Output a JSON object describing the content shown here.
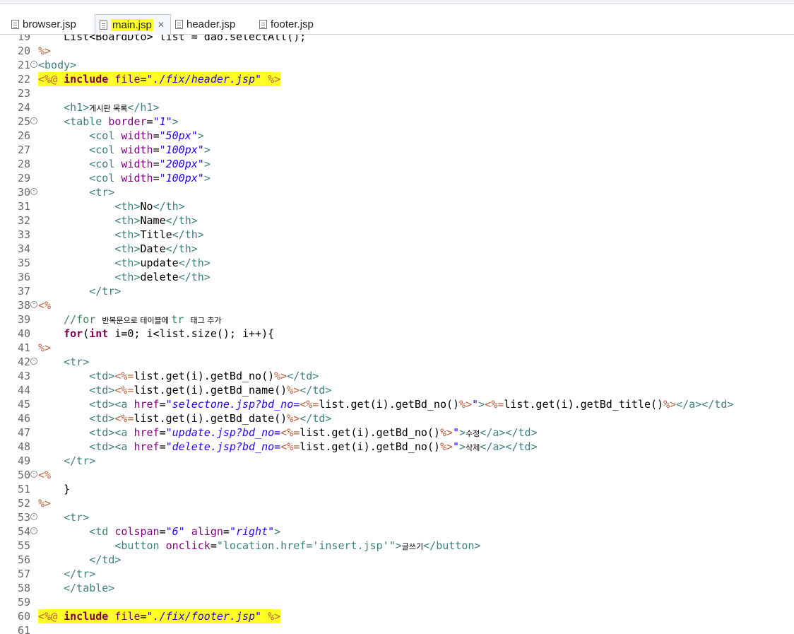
{
  "tabs": [
    {
      "name": "tab-browser",
      "label": "browser.jsp",
      "active": false,
      "highlight": false
    },
    {
      "name": "tab-main",
      "label": "main.jsp",
      "active": true,
      "highlight": true
    },
    {
      "name": "tab-header",
      "label": "header.jsp",
      "active": false,
      "highlight": false
    },
    {
      "name": "tab-footer",
      "label": "footer.jsp",
      "active": false,
      "highlight": false
    }
  ],
  "close_glyph": "✕",
  "lines": [
    {
      "n": "19",
      "fold": false,
      "hl": false,
      "t": [
        [
          "tx",
          "    List<BoardDto> list = dao.selectAll();"
        ]
      ]
    },
    {
      "n": "20",
      "fold": false,
      "hl": false,
      "t": [
        [
          "sc",
          "%>"
        ]
      ]
    },
    {
      "n": "21",
      "fold": true,
      "hl": false,
      "t": [
        [
          "tg",
          "<body>"
        ]
      ]
    },
    {
      "n": "22",
      "fold": false,
      "hl": true,
      "t": [
        [
          "sc",
          "<%@ "
        ],
        [
          "kw",
          "include"
        ],
        [
          "tx",
          " "
        ],
        [
          "at",
          "file"
        ],
        [
          "tx",
          "="
        ],
        [
          "sv",
          "\"./fix/header.jsp\""
        ],
        [
          "tx",
          " "
        ],
        [
          "sc",
          "%>"
        ]
      ]
    },
    {
      "n": "23",
      "fold": false,
      "hl": false,
      "t": []
    },
    {
      "n": "24",
      "fold": false,
      "hl": false,
      "t": [
        [
          "tx",
          "    "
        ],
        [
          "tg",
          "<h1>"
        ],
        [
          "ko",
          "게시판 목록"
        ],
        [
          "tg",
          "</h1>"
        ]
      ]
    },
    {
      "n": "25",
      "fold": true,
      "hl": false,
      "t": [
        [
          "tx",
          "    "
        ],
        [
          "tg",
          "<table "
        ],
        [
          "at",
          "border"
        ],
        [
          "tx",
          "="
        ],
        [
          "sv",
          "\"1\""
        ],
        [
          "tg",
          ">"
        ]
      ]
    },
    {
      "n": "26",
      "fold": false,
      "hl": false,
      "t": [
        [
          "tx",
          "        "
        ],
        [
          "tg",
          "<col "
        ],
        [
          "at",
          "width"
        ],
        [
          "tx",
          "="
        ],
        [
          "sv",
          "\"50px\""
        ],
        [
          "tg",
          ">"
        ]
      ]
    },
    {
      "n": "27",
      "fold": false,
      "hl": false,
      "t": [
        [
          "tx",
          "        "
        ],
        [
          "tg",
          "<col "
        ],
        [
          "at",
          "width"
        ],
        [
          "tx",
          "="
        ],
        [
          "sv",
          "\"100px\""
        ],
        [
          "tg",
          ">"
        ]
      ]
    },
    {
      "n": "28",
      "fold": false,
      "hl": false,
      "t": [
        [
          "tx",
          "        "
        ],
        [
          "tg",
          "<col "
        ],
        [
          "at",
          "width"
        ],
        [
          "tx",
          "="
        ],
        [
          "sv",
          "\"200px\""
        ],
        [
          "tg",
          ">"
        ]
      ]
    },
    {
      "n": "29",
      "fold": false,
      "hl": false,
      "t": [
        [
          "tx",
          "        "
        ],
        [
          "tg",
          "<col "
        ],
        [
          "at",
          "width"
        ],
        [
          "tx",
          "="
        ],
        [
          "sv",
          "\"100px\""
        ],
        [
          "tg",
          ">"
        ]
      ]
    },
    {
      "n": "30",
      "fold": true,
      "hl": false,
      "t": [
        [
          "tx",
          "        "
        ],
        [
          "tg",
          "<tr>"
        ]
      ]
    },
    {
      "n": "31",
      "fold": false,
      "hl": false,
      "t": [
        [
          "tx",
          "            "
        ],
        [
          "tg",
          "<th>"
        ],
        [
          "tx",
          "No"
        ],
        [
          "tg",
          "</th>"
        ]
      ]
    },
    {
      "n": "32",
      "fold": false,
      "hl": false,
      "t": [
        [
          "tx",
          "            "
        ],
        [
          "tg",
          "<th>"
        ],
        [
          "tx",
          "Name"
        ],
        [
          "tg",
          "</th>"
        ]
      ]
    },
    {
      "n": "33",
      "fold": false,
      "hl": false,
      "t": [
        [
          "tx",
          "            "
        ],
        [
          "tg",
          "<th>"
        ],
        [
          "tx",
          "Title"
        ],
        [
          "tg",
          "</th>"
        ]
      ]
    },
    {
      "n": "34",
      "fold": false,
      "hl": false,
      "t": [
        [
          "tx",
          "            "
        ],
        [
          "tg",
          "<th>"
        ],
        [
          "tx",
          "Date"
        ],
        [
          "tg",
          "</th>"
        ]
      ]
    },
    {
      "n": "35",
      "fold": false,
      "hl": false,
      "t": [
        [
          "tx",
          "            "
        ],
        [
          "tg",
          "<th>"
        ],
        [
          "tx",
          "update"
        ],
        [
          "tg",
          "</th>"
        ]
      ]
    },
    {
      "n": "36",
      "fold": false,
      "hl": false,
      "t": [
        [
          "tx",
          "            "
        ],
        [
          "tg",
          "<th>"
        ],
        [
          "tx",
          "delete"
        ],
        [
          "tg",
          "</th>"
        ]
      ]
    },
    {
      "n": "37",
      "fold": false,
      "hl": false,
      "t": [
        [
          "tx",
          "        "
        ],
        [
          "tg",
          "</tr>"
        ]
      ]
    },
    {
      "n": "38",
      "fold": true,
      "hl": false,
      "t": [
        [
          "sc",
          "<%"
        ]
      ]
    },
    {
      "n": "39",
      "fold": false,
      "hl": false,
      "t": [
        [
          "tx",
          "    "
        ],
        [
          "cm",
          "//for "
        ],
        [
          "ko",
          "반복문으로 테이블에 "
        ],
        [
          "cm",
          "tr "
        ],
        [
          "ko",
          "태그 추가"
        ]
      ]
    },
    {
      "n": "40",
      "fold": false,
      "hl": false,
      "t": [
        [
          "tx",
          "    "
        ],
        [
          "kw",
          "for"
        ],
        [
          "tx",
          "("
        ],
        [
          "kw",
          "int"
        ],
        [
          "tx",
          " i=0; i<list.size(); i++){"
        ]
      ]
    },
    {
      "n": "41",
      "fold": false,
      "hl": false,
      "t": [
        [
          "sc",
          "%>"
        ]
      ]
    },
    {
      "n": "42",
      "fold": true,
      "hl": false,
      "t": [
        [
          "tx",
          "    "
        ],
        [
          "tg",
          "<tr>"
        ]
      ]
    },
    {
      "n": "43",
      "fold": false,
      "hl": false,
      "t": [
        [
          "tx",
          "        "
        ],
        [
          "tg",
          "<td>"
        ],
        [
          "sc",
          "<%="
        ],
        [
          "tx",
          "list.get(i).getBd_no()"
        ],
        [
          "sc",
          "%>"
        ],
        [
          "tg",
          "</td>"
        ]
      ]
    },
    {
      "n": "44",
      "fold": false,
      "hl": false,
      "t": [
        [
          "tx",
          "        "
        ],
        [
          "tg",
          "<td>"
        ],
        [
          "sc",
          "<%="
        ],
        [
          "tx",
          "list.get(i).getBd_name()"
        ],
        [
          "sc",
          "%>"
        ],
        [
          "tg",
          "</td>"
        ]
      ]
    },
    {
      "n": "45",
      "fold": false,
      "hl": false,
      "t": [
        [
          "tx",
          "        "
        ],
        [
          "tg",
          "<td><a "
        ],
        [
          "at",
          "href"
        ],
        [
          "tx",
          "="
        ],
        [
          "sv",
          "\"selectone.jsp?bd_no="
        ],
        [
          "sc",
          "<%="
        ],
        [
          "tx",
          "list.get(i).getBd_no()"
        ],
        [
          "sc",
          "%>"
        ],
        [
          "sv",
          "\""
        ],
        [
          "tg",
          ">"
        ],
        [
          "sc",
          "<%="
        ],
        [
          "tx",
          "list.get(i).getBd_title()"
        ],
        [
          "sc",
          "%>"
        ],
        [
          "tg",
          "</a></td>"
        ]
      ]
    },
    {
      "n": "46",
      "fold": false,
      "hl": false,
      "t": [
        [
          "tx",
          "        "
        ],
        [
          "tg",
          "<td>"
        ],
        [
          "sc",
          "<%="
        ],
        [
          "tx",
          "list.get(i).getBd_date()"
        ],
        [
          "sc",
          "%>"
        ],
        [
          "tg",
          "</td>"
        ]
      ]
    },
    {
      "n": "47",
      "fold": false,
      "hl": false,
      "t": [
        [
          "tx",
          "        "
        ],
        [
          "tg",
          "<td><a "
        ],
        [
          "at",
          "href"
        ],
        [
          "tx",
          "="
        ],
        [
          "sv",
          "\"update.jsp?bd_no="
        ],
        [
          "sc",
          "<%="
        ],
        [
          "tx",
          "list.get(i).getBd_no()"
        ],
        [
          "sc",
          "%>"
        ],
        [
          "sv",
          "\""
        ],
        [
          "tg",
          ">"
        ],
        [
          "ko",
          "수정"
        ],
        [
          "tg",
          "</a></td>"
        ]
      ]
    },
    {
      "n": "48",
      "fold": false,
      "hl": false,
      "t": [
        [
          "tx",
          "        "
        ],
        [
          "tg",
          "<td><a "
        ],
        [
          "at",
          "href"
        ],
        [
          "tx",
          "="
        ],
        [
          "sv",
          "\"delete.jsp?bd_no="
        ],
        [
          "sc",
          "<%="
        ],
        [
          "tx",
          "list.get(i).getBd_no()"
        ],
        [
          "sc",
          "%>"
        ],
        [
          "sv",
          "\""
        ],
        [
          "tg",
          ">"
        ],
        [
          "ko",
          "삭제"
        ],
        [
          "tg",
          "</a></td>"
        ]
      ]
    },
    {
      "n": "49",
      "fold": false,
      "hl": false,
      "t": [
        [
          "tx",
          "    "
        ],
        [
          "tg",
          "</tr>"
        ]
      ]
    },
    {
      "n": "50",
      "fold": true,
      "hl": false,
      "t": [
        [
          "sc",
          "<%"
        ]
      ]
    },
    {
      "n": "51",
      "fold": false,
      "hl": false,
      "t": [
        [
          "tx",
          "    }"
        ]
      ]
    },
    {
      "n": "52",
      "fold": false,
      "hl": false,
      "t": [
        [
          "sc",
          "%>"
        ]
      ]
    },
    {
      "n": "53",
      "fold": true,
      "hl": false,
      "t": [
        [
          "tx",
          "    "
        ],
        [
          "tg",
          "<tr>"
        ]
      ]
    },
    {
      "n": "54",
      "fold": true,
      "hl": false,
      "t": [
        [
          "tx",
          "        "
        ],
        [
          "tg",
          "<td "
        ],
        [
          "at",
          "colspan"
        ],
        [
          "tx",
          "="
        ],
        [
          "sv",
          "\"6\""
        ],
        [
          "tx",
          " "
        ],
        [
          "at",
          "align"
        ],
        [
          "tx",
          "="
        ],
        [
          "sv",
          "\"right\""
        ],
        [
          "tg",
          ">"
        ]
      ]
    },
    {
      "n": "55",
      "fold": false,
      "hl": false,
      "t": [
        [
          "tx",
          "            "
        ],
        [
          "tg",
          "<button "
        ],
        [
          "at",
          "onclick"
        ],
        [
          "tx",
          "="
        ],
        [
          "tg",
          "\"location.href='insert.jsp'\""
        ],
        [
          "tg",
          ">"
        ],
        [
          "ko",
          "글쓰기"
        ],
        [
          "tg",
          "</button>"
        ]
      ]
    },
    {
      "n": "56",
      "fold": false,
      "hl": false,
      "t": [
        [
          "tx",
          "        "
        ],
        [
          "tg",
          "</td>"
        ]
      ]
    },
    {
      "n": "57",
      "fold": false,
      "hl": false,
      "t": [
        [
          "tx",
          "    "
        ],
        [
          "tg",
          "</tr>"
        ]
      ]
    },
    {
      "n": "58",
      "fold": false,
      "hl": false,
      "t": [
        [
          "tx",
          "    "
        ],
        [
          "tg",
          "</table>"
        ]
      ]
    },
    {
      "n": "59",
      "fold": false,
      "hl": false,
      "t": []
    },
    {
      "n": "60",
      "fold": false,
      "hl": true,
      "t": [
        [
          "sc",
          "<%@ "
        ],
        [
          "kw",
          "include"
        ],
        [
          "tx",
          " "
        ],
        [
          "at",
          "file"
        ],
        [
          "tx",
          "="
        ],
        [
          "sv",
          "\"./fix/footer.jsp\""
        ],
        [
          "tx",
          " "
        ],
        [
          "sc",
          "%>"
        ]
      ]
    },
    {
      "n": "61",
      "fold": false,
      "hl": false,
      "t": []
    }
  ]
}
